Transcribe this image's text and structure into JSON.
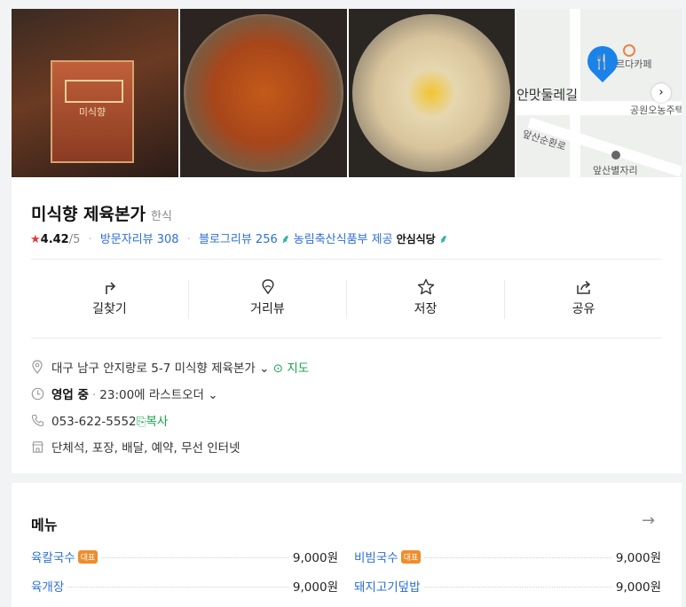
{
  "place": {
    "name": "미식향 제육본가",
    "category": "한식",
    "rating_star": "★",
    "rating": "4.42",
    "rating_max": "/5",
    "visitor_reviews": "방문자리뷰 308",
    "blog_reviews": "블로그리뷰 256",
    "certification": "농림축산식품부 제공",
    "certification_brand": "안심식당"
  },
  "photos": {
    "sign_text": "미식향",
    "map_labels": {
      "street": "안맛둘레길",
      "cafe": "르다카페",
      "park": "공원오농주택",
      "ring_road": "앞산순환로",
      "landmark": "앞산별자리"
    }
  },
  "actions": [
    {
      "label": "길찾기",
      "icon": "directions-icon"
    },
    {
      "label": "거리뷰",
      "icon": "streetview-icon"
    },
    {
      "label": "저장",
      "icon": "star-icon"
    },
    {
      "label": "공유",
      "icon": "share-icon"
    }
  ],
  "info": {
    "address": "대구 남구 안지랑로 5-7 미식향 제육본가",
    "map_link": "지도",
    "hours_status": "영업 중",
    "hours_detail": "23:00에 라스트오더",
    "phone": "053-622-5552",
    "copy_label": "복사",
    "amenities": "단체석, 포장, 배달, 예약, 무선 인터넷"
  },
  "menu": {
    "title": "메뉴",
    "badge_text": "대표",
    "items": [
      {
        "name": "육칼국수",
        "price": "9,000원",
        "badge": true
      },
      {
        "name": "비빔국수",
        "price": "9,000원",
        "badge": true
      },
      {
        "name": "육개장",
        "price": "9,000원",
        "badge": false
      },
      {
        "name": "돼지고기덮밥",
        "price": "9,000원",
        "badge": false
      }
    ]
  },
  "colors": {
    "accent_blue": "#2b6fd6",
    "rating_red": "#e8343e",
    "open_green": "#16a34a",
    "badge_orange": "#f08c2a"
  }
}
